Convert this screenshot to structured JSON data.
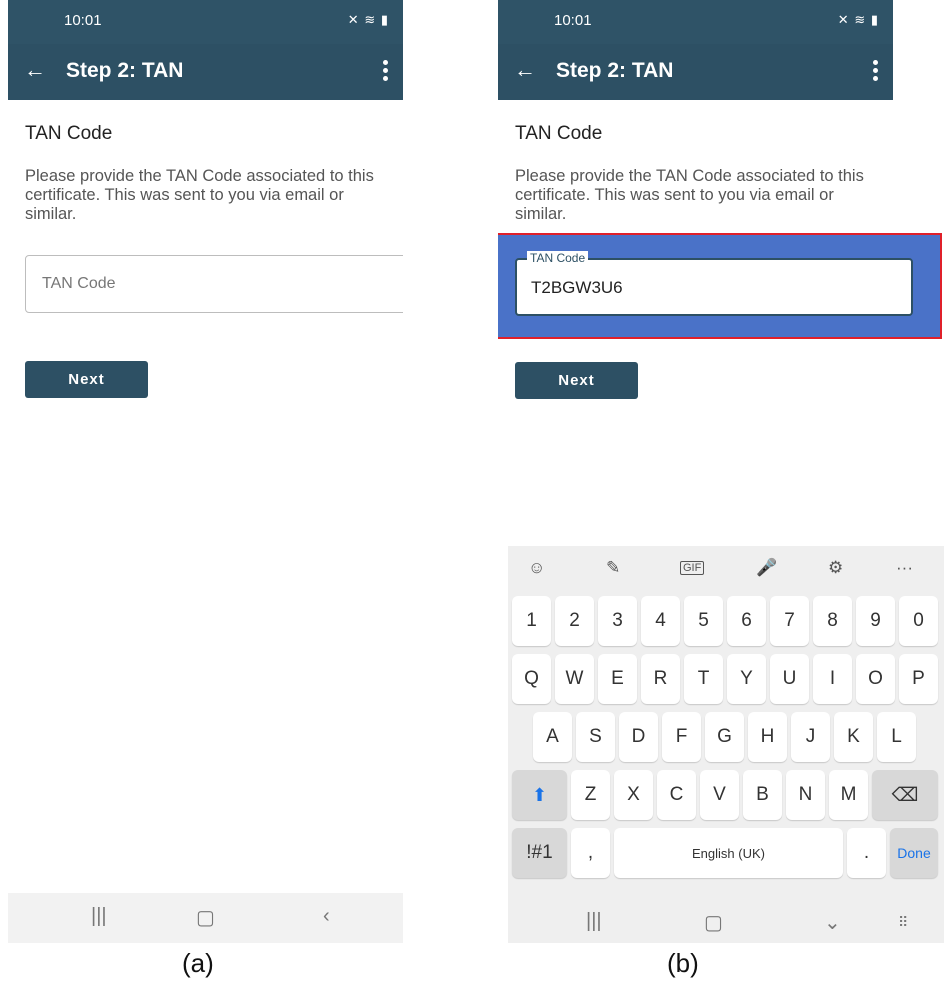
{
  "status": {
    "time": "10:01",
    "icons_text": "☒ ◎",
    "right_icons": "✕ ▲ ▮"
  },
  "app_bar": {
    "title": "Step 2: TAN"
  },
  "section_title": "TAN Code",
  "instructions": "Please provide the TAN Code associated to this certificate. This was sent to you via email or similar.",
  "input": {
    "placeholder": "TAN Code",
    "label": "TAN Code",
    "value": "T2BGW3U6"
  },
  "next_label": "Next",
  "keyboard": {
    "toolbar": [
      "☺",
      "✎",
      "GIF",
      "🎤",
      "⚙",
      "···"
    ],
    "numbers": [
      "1",
      "2",
      "3",
      "4",
      "5",
      "6",
      "7",
      "8",
      "9",
      "0"
    ],
    "row1": [
      "Q",
      "W",
      "E",
      "R",
      "T",
      "Y",
      "U",
      "I",
      "O",
      "P"
    ],
    "row2": [
      "A",
      "S",
      "D",
      "F",
      "G",
      "H",
      "J",
      "K",
      "L"
    ],
    "row3": [
      "Z",
      "X",
      "C",
      "V",
      "B",
      "N",
      "M"
    ],
    "symbols_label": "!#1",
    "comma": ",",
    "space_label": "English (UK)",
    "period": ".",
    "done_label": "Done"
  },
  "nav": {
    "recent": "|||",
    "home": "▢",
    "back": "‹",
    "down": "⌄",
    "keyboard_switch": "⠿"
  },
  "captions": {
    "a": "(a)",
    "b": "(b)"
  }
}
